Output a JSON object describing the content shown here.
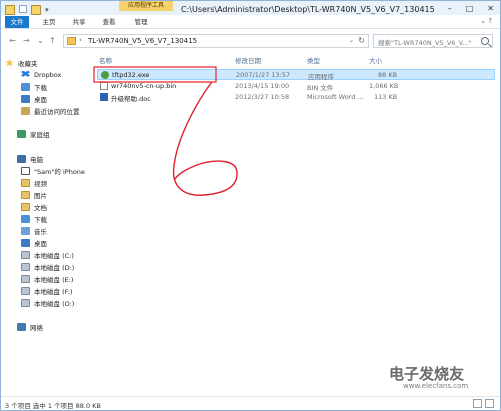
{
  "window": {
    "title": "C:\\Users\\Administrator\\Desktop\\TL-WR740N_V5_V6_V7_130415",
    "context_tab": "应用程序工具"
  },
  "ribbon": {
    "tabs": [
      "文件",
      "主页",
      "共享",
      "查看",
      "管理"
    ]
  },
  "address": {
    "path": "TL-WR740N_V5_V6_V7_130415",
    "search_placeholder": "搜索\"TL-WR740N_V5_V6_V...\""
  },
  "nav": {
    "favorites": "收藏夹",
    "dropbox": "Dropbox",
    "downloads": "下载",
    "desktop": "桌面",
    "recent": "最近访问的位置",
    "homegroup": "家庭组",
    "computer": "电脑",
    "phone": "\"Sam\"的 iPhone",
    "videos": "视频",
    "pictures": "图片",
    "documents": "文档",
    "downloads2": "下载",
    "music": "音乐",
    "desktop2": "桌面",
    "drive_c": "本地磁盘 (C:)",
    "drive_d": "本地磁盘 (D:)",
    "drive_e": "本地磁盘 (E:)",
    "drive_f": "本地磁盘 (F:)",
    "drive_o": "本地磁盘 (O:)",
    "network": "网络"
  },
  "columns": {
    "name": "名称",
    "date": "修改日期",
    "type": "类型",
    "size": "大小"
  },
  "files": [
    {
      "name": "tftpd32.exe",
      "date": "2007/1/27 13:57",
      "type": "应用程序",
      "size": "88 KB",
      "icon": "exe-icon"
    },
    {
      "name": "wr740nv5-cn-up.bin",
      "date": "2013/4/15 19:00",
      "type": "BIN 文件",
      "size": "1,066 KB",
      "icon": "bin-icon"
    },
    {
      "name": "升级帮助.doc",
      "date": "2012/3/27 10:58",
      "type": "Microsoft Word ...",
      "size": "113 KB",
      "icon": "doc-icon"
    }
  ],
  "status": {
    "text": "3 个项目   选中 1 个项目 88.0 KB"
  },
  "watermark": {
    "logo": "电子发烧友",
    "url": "www.elecfans.com"
  },
  "colors": {
    "accent": "#1979ca",
    "selection": "#cce8ff",
    "annotation": "#e0202a"
  }
}
